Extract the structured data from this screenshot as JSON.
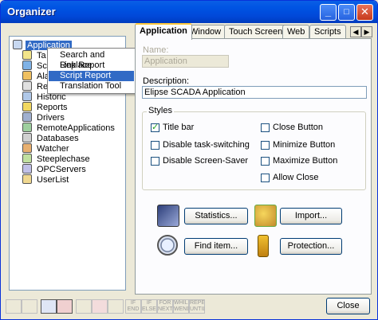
{
  "window": {
    "title": "Organizer"
  },
  "titlebar_buttons": {
    "minimize": "_",
    "maximize": "□",
    "close": "✕"
  },
  "tree": {
    "items": [
      {
        "label": "Application",
        "selected": true
      },
      {
        "label": "Ta"
      },
      {
        "label": "Sc"
      },
      {
        "label": "Ala"
      },
      {
        "label": "Re"
      },
      {
        "label": "Historic"
      },
      {
        "label": "Reports"
      },
      {
        "label": "Drivers"
      },
      {
        "label": "RemoteApplications"
      },
      {
        "label": "Databases"
      },
      {
        "label": "Watcher"
      },
      {
        "label": "Steeplechase"
      },
      {
        "label": "OPCServers"
      },
      {
        "label": "UserList"
      }
    ]
  },
  "context_menu": {
    "items": [
      {
        "label": "Search and Replace"
      },
      {
        "label": "Link Report"
      },
      {
        "label": "Script Report",
        "highlighted": true
      },
      {
        "label": "Translation Tool"
      }
    ]
  },
  "tabs": [
    "Application",
    "Window",
    "Touch Screen",
    "Web",
    "Scripts"
  ],
  "form": {
    "name_label": "Name:",
    "name_value": "Application",
    "description_label": "Description:",
    "description_value": "Elipse SCADA Application",
    "styles_title": "Styles",
    "options_left": [
      {
        "label": "Title bar",
        "checked": true
      },
      {
        "label": "Disable task-switching",
        "checked": false
      },
      {
        "label": "Disable Screen-Saver",
        "checked": false
      }
    ],
    "options_right": [
      {
        "label": "Close Button",
        "checked": false
      },
      {
        "label": "Minimize Button",
        "checked": false
      },
      {
        "label": "Maximize Button",
        "checked": false
      },
      {
        "label": "Allow Close",
        "checked": false
      }
    ]
  },
  "actions": {
    "statistics": "Statistics...",
    "import": "Import...",
    "find_item": "Find item...",
    "protection": "Protection..."
  },
  "bottom": {
    "close": "Close",
    "tools": [
      "IF END",
      "IF ELSE END",
      "FOR NEXT",
      "WHILE WEND",
      "REPE UNTIL"
    ]
  }
}
